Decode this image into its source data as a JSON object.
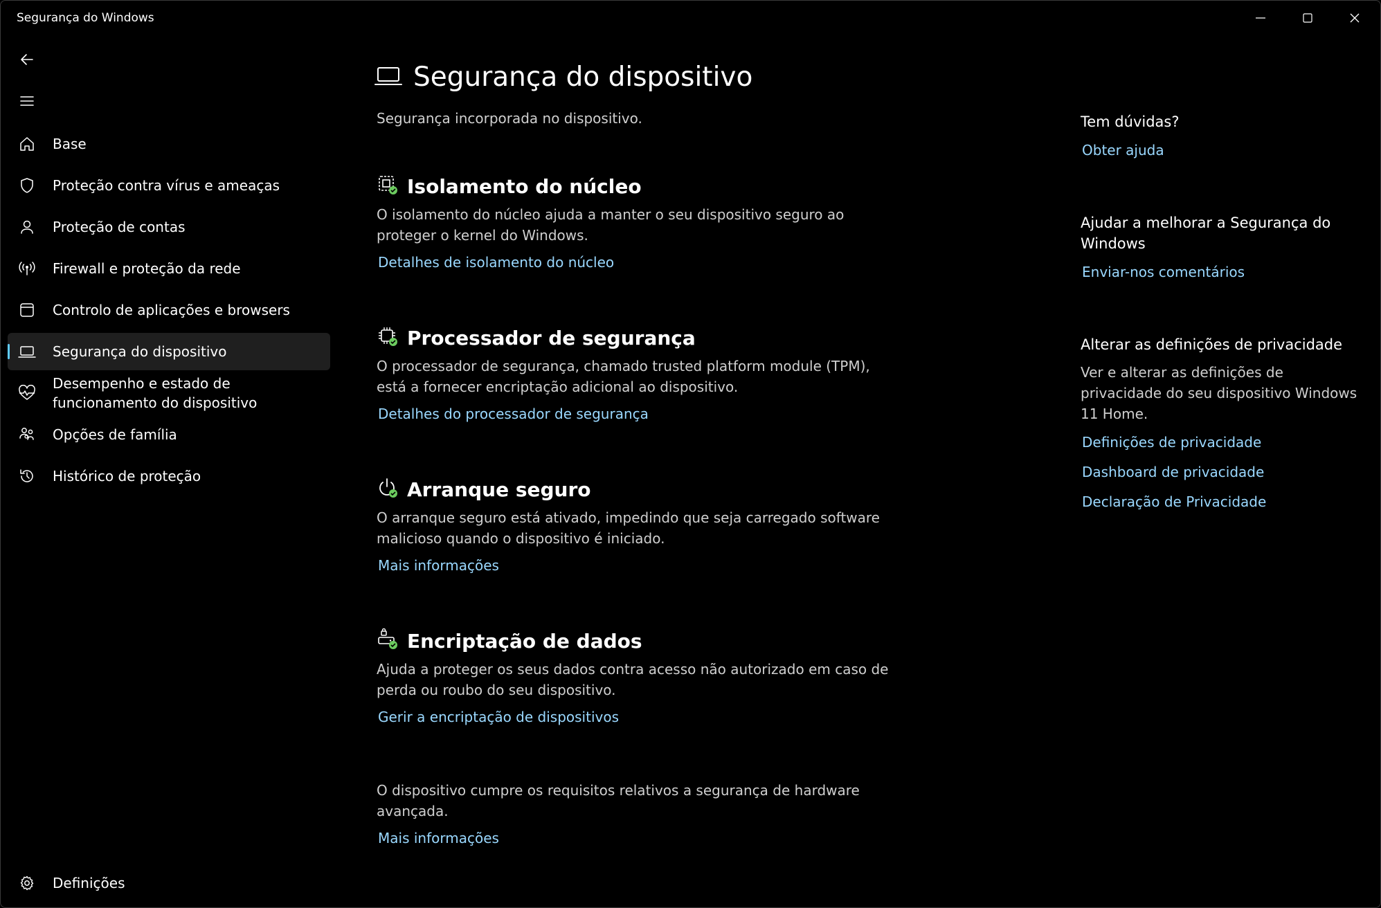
{
  "window": {
    "title": "Segurança do Windows"
  },
  "sidebar": {
    "items": [
      {
        "label": "Base",
        "icon": "home-icon"
      },
      {
        "label": "Proteção contra vírus e ameaças",
        "icon": "shield-icon"
      },
      {
        "label": "Proteção de contas",
        "icon": "person-icon"
      },
      {
        "label": "Firewall e proteção da rede",
        "icon": "wireless-icon"
      },
      {
        "label": "Controlo de aplicações e browsers",
        "icon": "app-window-icon"
      },
      {
        "label": "Segurança do dispositivo",
        "icon": "laptop-icon",
        "active": true
      },
      {
        "label": "Desempenho e estado de\nfuncionamento do dispositivo",
        "icon": "heart-pulse-icon"
      },
      {
        "label": "Opções de família",
        "icon": "family-icon"
      },
      {
        "label": "Histórico de proteção",
        "icon": "history-icon"
      }
    ],
    "settings_label": "Definições"
  },
  "main": {
    "title": "Segurança do dispositivo",
    "subtitle": "Segurança incorporada no dispositivo.",
    "sections": [
      {
        "title": "Isolamento do núcleo",
        "desc": "O isolamento do núcleo ajuda a manter o seu dispositivo seguro ao proteger o kernel do Windows.",
        "link": "Detalhes de isolamento do núcleo"
      },
      {
        "title": "Processador de segurança",
        "desc": "O processador de segurança, chamado trusted platform module (TPM), está a fornecer encriptação adicional ao dispositivo.",
        "link": "Detalhes do processador de segurança"
      },
      {
        "title": "Arranque seguro",
        "desc": "O arranque seguro está ativado, impedindo que seja carregado software malicioso quando o dispositivo é iniciado.",
        "link": "Mais informações"
      },
      {
        "title": "Encriptação de dados",
        "desc": "Ajuda a proteger os seus dados contra acesso não autorizado em caso de perda ou roubo do seu dispositivo.",
        "link": "Gerir a encriptação de dispositivos"
      }
    ],
    "footer": {
      "desc": "O dispositivo cumpre os requisitos relativos a segurança de hardware avançada.",
      "link": "Mais informações"
    }
  },
  "aside": {
    "help_title": "Tem dúvidas?",
    "help_link": "Obter ajuda",
    "improve_title": "Ajudar a melhorar a Segurança do Windows",
    "improve_link": "Enviar-nos comentários",
    "privacy_title": "Alterar as definições de privacidade",
    "privacy_desc": "Ver e alterar as definições de privacidade do seu dispositivo Windows 11 Home.",
    "privacy_links": [
      "Definições de privacidade",
      "Dashboard de privacidade",
      "Declaração de Privacidade"
    ]
  },
  "colors": {
    "accent": "#60cdff",
    "link": "#9ad8ff",
    "ok_badge": "#6ccb5f"
  }
}
